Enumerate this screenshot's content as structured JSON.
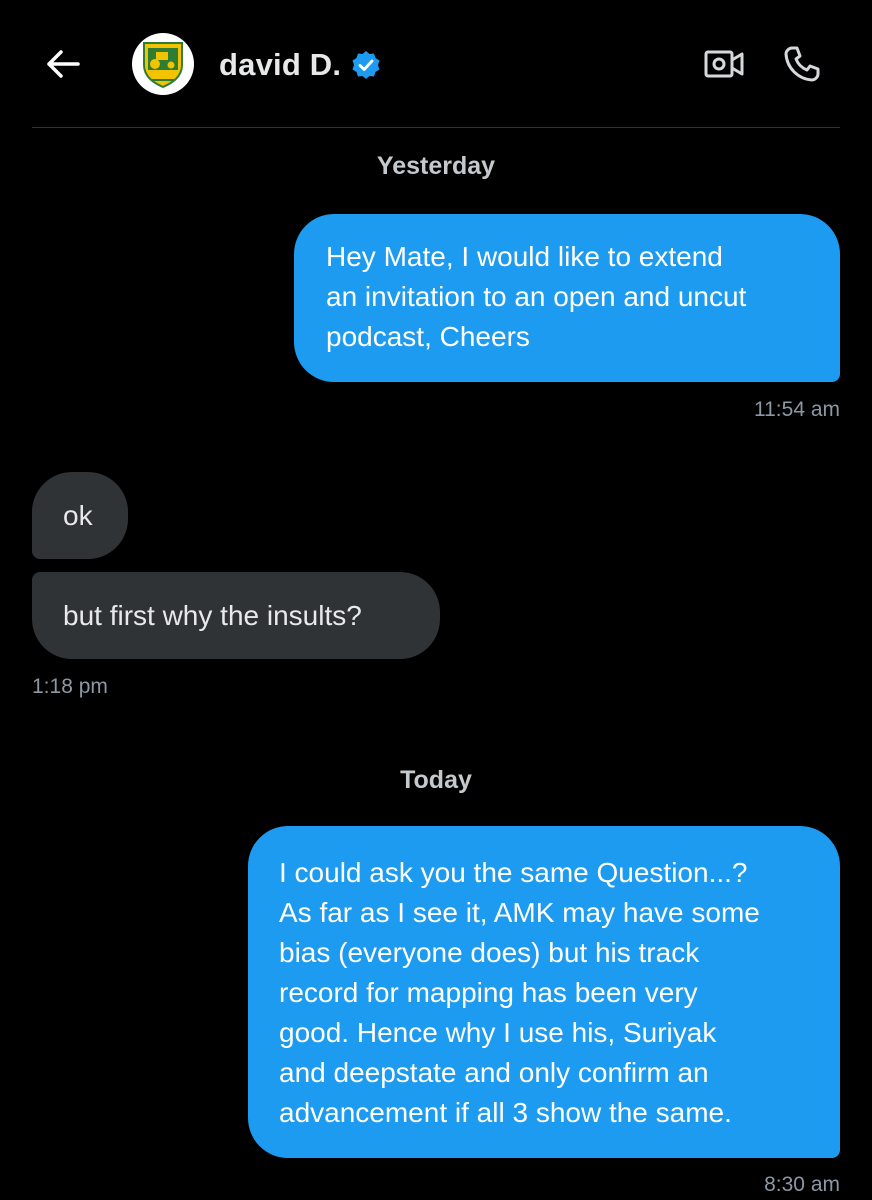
{
  "header": {
    "back_icon": "arrow-left-icon",
    "avatar_icon": "tractor-logo-icon",
    "name": "david D.",
    "verified_icon": "verified-badge-icon",
    "video_icon": "video-camera-icon",
    "call_icon": "phone-icon"
  },
  "colors": {
    "background": "#000000",
    "outgoing_bubble": "#1d9bf0",
    "incoming_bubble": "#2f3336",
    "timestamp": "#8b98a5"
  },
  "conversation": {
    "sep_yesterday": "Yesterday",
    "msg1": {
      "line1": "Hey Mate, I would like to extend",
      "line2": "an invitation to an open and uncut",
      "line3": "podcast, Cheers",
      "time": "11:54 am"
    },
    "msg2": {
      "text": "ok"
    },
    "msg3": {
      "text": "but first why the insults?",
      "time": "1:18 pm"
    },
    "sep_today": "Today",
    "msg4": {
      "line1": "I could ask you the same Question...?",
      "line2": "As far as I see it, AMK may have some",
      "line3": "bias (everyone does) but his track",
      "line4": "record for mapping has been very",
      "line5": "good. Hence why I use his, Suriyak",
      "line6": "and deepstate and only confirm an",
      "line7": "advancement if all 3 show the same.",
      "time": "8:30 am"
    }
  }
}
